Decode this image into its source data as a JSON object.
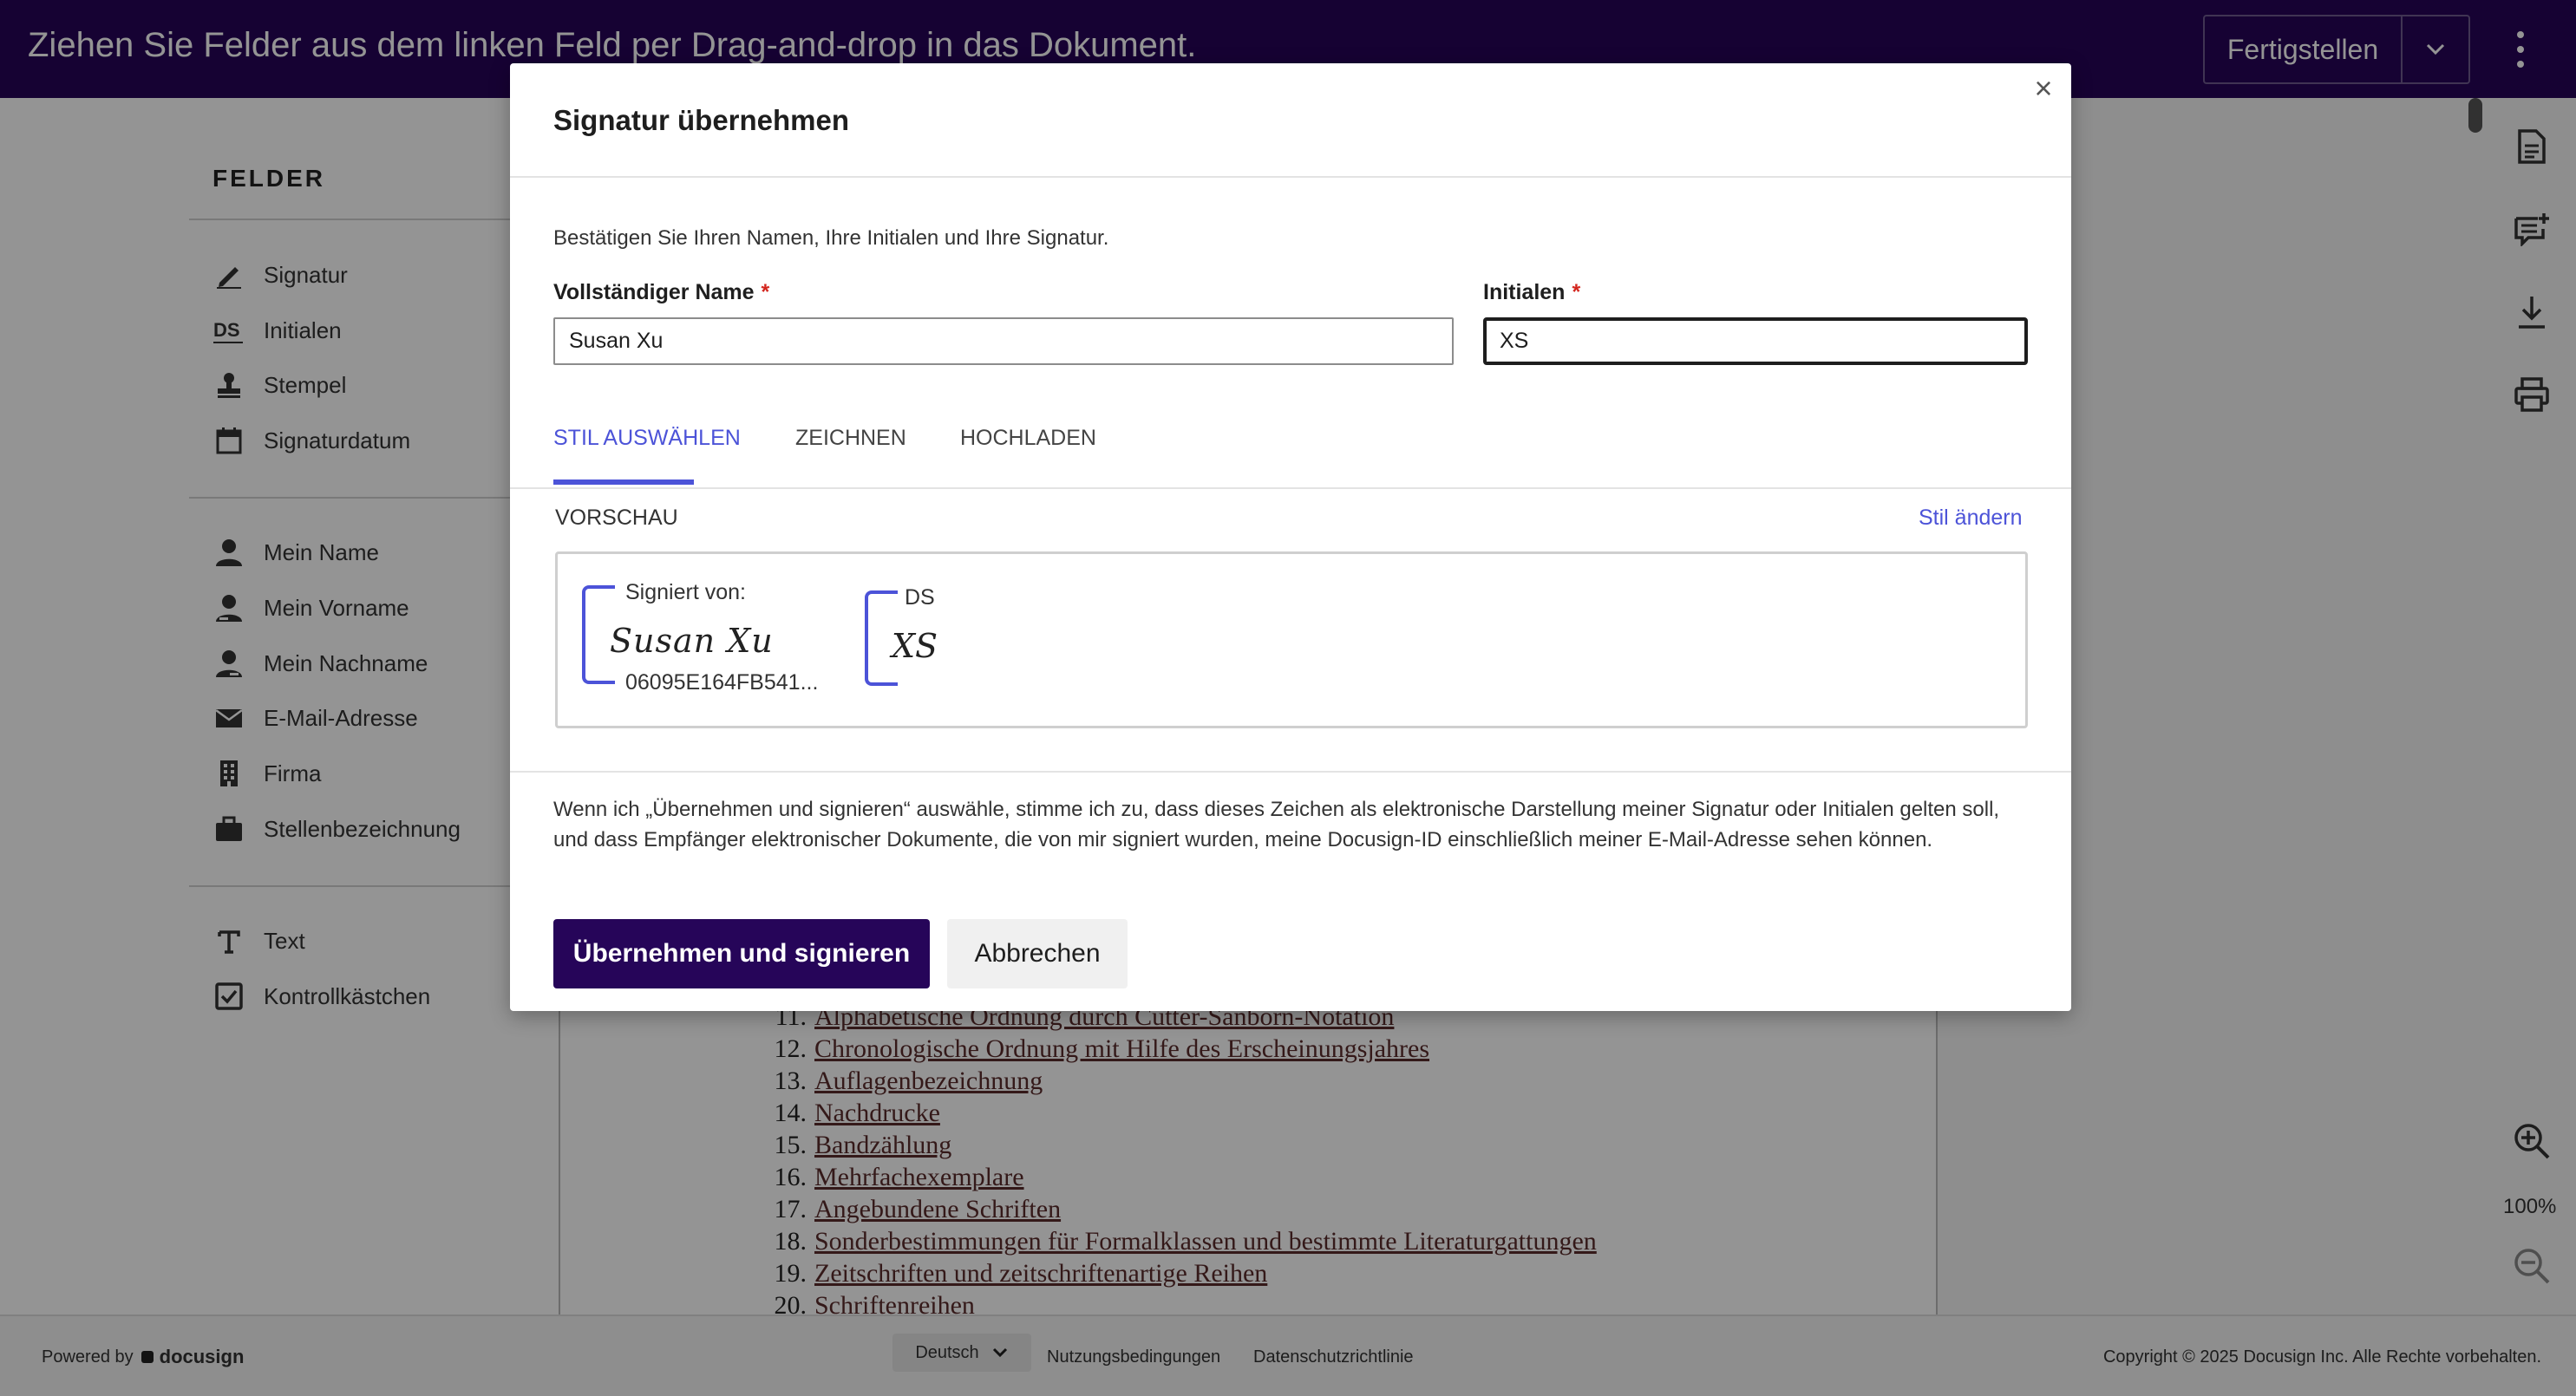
{
  "topbar": {
    "message": "Ziehen Sie Felder aus dem linken Feld per Drag-and-drop in das Dokument.",
    "finish_label": "Fertigstellen"
  },
  "left_panel": {
    "title": "FELDER",
    "groups": [
      [
        {
          "label": "Signatur",
          "icon": "pen-icon"
        },
        {
          "label": "Initialen",
          "icon": "initials-ds-icon"
        },
        {
          "label": "Stempel",
          "icon": "stamp-icon"
        },
        {
          "label": "Signaturdatum",
          "icon": "calendar-icon"
        }
      ],
      [
        {
          "label": "Mein Name",
          "icon": "person-icon"
        },
        {
          "label": "Mein Vorname",
          "icon": "person-icon"
        },
        {
          "label": "Mein Nachname",
          "icon": "person-icon"
        },
        {
          "label": "E-Mail-Adresse",
          "icon": "envelope-icon"
        },
        {
          "label": "Firma",
          "icon": "building-icon"
        },
        {
          "label": "Stellenbezeichnung",
          "icon": "briefcase-icon"
        }
      ],
      [
        {
          "label": "Text",
          "icon": "text-t-icon"
        },
        {
          "label": "Kontrollkästchen",
          "icon": "checkbox-icon"
        }
      ]
    ]
  },
  "document": {
    "toc": [
      {
        "num": "11.",
        "text": "Alphabetische Ordnung durch Cutter-Sanborn-Notation"
      },
      {
        "num": "12.",
        "text": "Chronologische Ordnung mit Hilfe des Erscheinungsjahres"
      },
      {
        "num": "13.",
        "text": "Auflagenbezeichnung"
      },
      {
        "num": "14.",
        "text": "Nachdrucke"
      },
      {
        "num": "15.",
        "text": "Bandzählung"
      },
      {
        "num": "16.",
        "text": "Mehrfachexemplare"
      },
      {
        "num": "17.",
        "text": "Angebundene Schriften"
      },
      {
        "num": "18.",
        "text": "Sonderbestimmungen für Formalklassen und bestimmte Literaturgattungen"
      },
      {
        "num": "19.",
        "text": "Zeitschriften und zeitschriftenartige Reihen"
      },
      {
        "num": "20.",
        "text": "Schriftenreihen"
      }
    ]
  },
  "right_rail": {
    "zoom_level": "100%"
  },
  "footer": {
    "powered_by": "Powered by",
    "brand": "docusign",
    "language": "Deutsch",
    "terms": "Nutzungsbedingungen",
    "privacy": "Datenschutzrichtlinie",
    "copyright": "Copyright © 2025 Docusign Inc. Alle Rechte vorbehalten."
  },
  "modal": {
    "title": "Signatur übernehmen",
    "close": "×",
    "confirm_text": "Bestätigen Sie Ihren Namen, Ihre Initialen und Ihre Signatur.",
    "full_name_label": "Vollständiger Name",
    "full_name_value": "Susan Xu",
    "initials_label": "Initialen",
    "initials_value": "XS",
    "required_mark": "*",
    "tabs": [
      "STIL AUSWÄHLEN",
      "ZEICHNEN",
      "HOCHLADEN"
    ],
    "active_tab": 0,
    "preview_label": "VORSCHAU",
    "change_style": "Stil ändern",
    "preview": {
      "signed_by": "Signiert von:",
      "signature_script": "Susan Xu",
      "signature_id": "06095E164FB541...",
      "initials_tag": "DS",
      "initials_script": "XS"
    },
    "legal_text": "Wenn ich „Übernehmen und signieren“ auswähle, stimme ich zu, dass dieses Zeichen als elektronische Darstellung meiner Signatur oder Initialen gelten soll, und dass Empfänger elektronischer Dokumente, die von mir signiert wurden, meine Docusign-ID einschließlich meiner E-Mail-Adresse sehen können.",
    "adopt_button": "Übernehmen und signieren",
    "cancel_button": "Abbrechen"
  },
  "colors": {
    "brand_purple": "#260559",
    "accent_blue": "#4c53d8",
    "required_red": "#d3261e"
  }
}
